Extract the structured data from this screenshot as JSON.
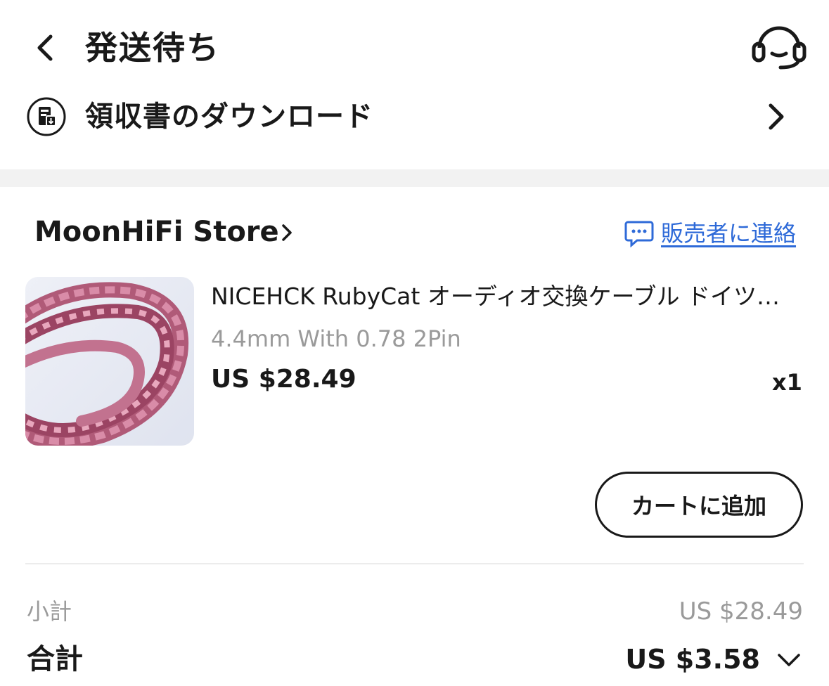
{
  "header": {
    "title": "発送待ち",
    "back_icon": "chevron-left-icon",
    "support_icon": "headset-icon"
  },
  "receipt": {
    "label": "領収書のダウンロード",
    "icon": "receipt-download-icon"
  },
  "store": {
    "name": "MoonHiFi Store",
    "contact_label": "販売者に連絡",
    "accent": "#2e6ad8"
  },
  "product": {
    "title": "NICEHCK RubyCat オーディオ交換ケーブル ドイツ…",
    "variant": "4.4mm With 0.78 2Pin",
    "price": "US $28.49",
    "quantity": "x1",
    "add_to_cart_label": "カートに追加"
  },
  "summary": {
    "subtotal_label": "小計",
    "subtotal_value": "US $28.49",
    "total_label": "合計",
    "total_value": "US $3.58"
  }
}
